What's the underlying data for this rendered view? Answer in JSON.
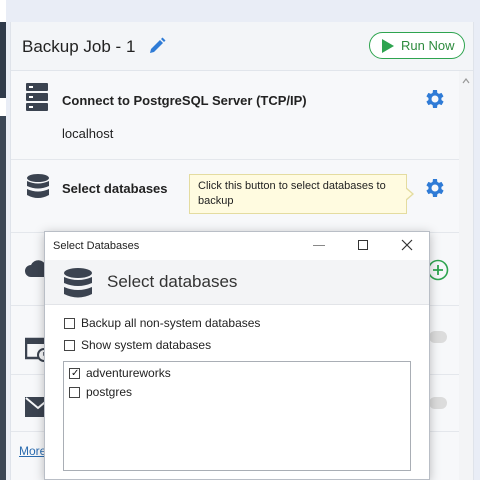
{
  "job": {
    "title": "Backup Job - 1",
    "run_now_label": "Run Now"
  },
  "sections": {
    "connect": {
      "title": "Connect to PostgreSQL Server (TCP/IP)",
      "value": "localhost"
    },
    "databases": {
      "title": "Select databases",
      "tooltip": "Click this button to select databases to backup"
    }
  },
  "more_link": "More",
  "dialog": {
    "window_title": "Select Databases",
    "heading": "Select databases",
    "options": [
      {
        "label": "Backup all non-system databases",
        "checked": false
      },
      {
        "label": "Show system databases",
        "checked": false
      }
    ],
    "databases": [
      {
        "label": "adventureworks",
        "checked": true
      },
      {
        "label": "postgres",
        "checked": false
      }
    ]
  },
  "colors": {
    "accent_blue": "#2f7bd6",
    "run_green": "#2ea44f",
    "tooltip_bg": "#fffbe0"
  },
  "icons": [
    "edit-icon",
    "play-icon",
    "server-icon",
    "database-icon",
    "gear-icon",
    "cloud-icon",
    "add-circle-icon",
    "calendar-icon",
    "mail-icon",
    "minimize-icon",
    "maximize-icon",
    "close-icon",
    "check-icon"
  ]
}
